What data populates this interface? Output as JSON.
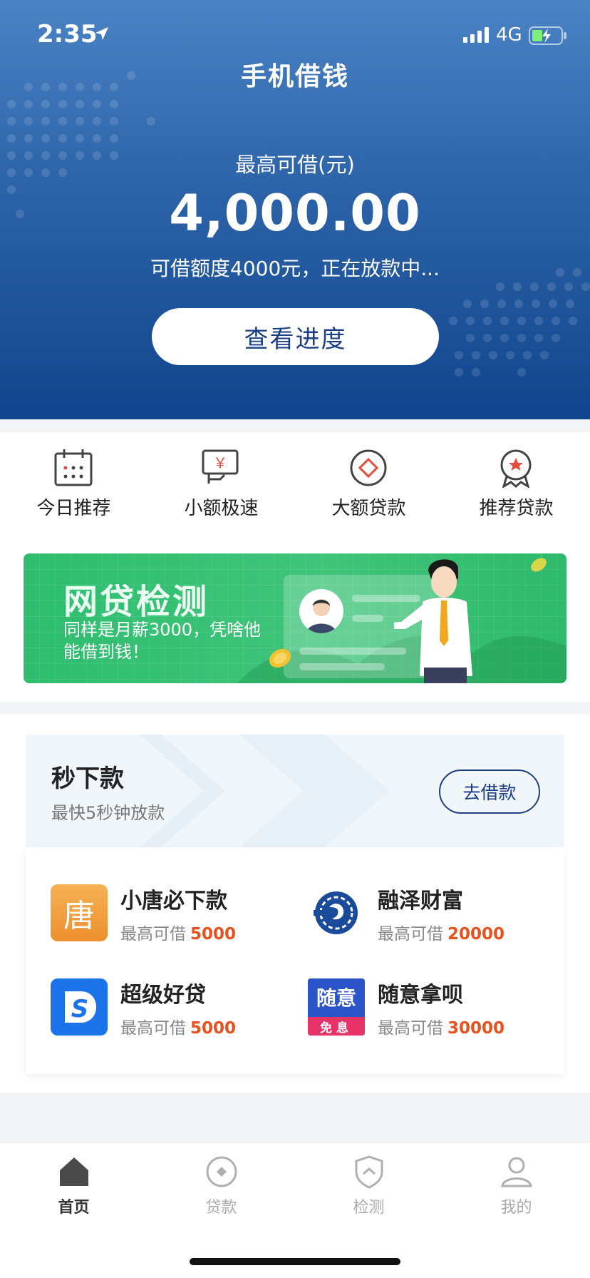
{
  "status_bar": {
    "time": "2:35",
    "network": "4G"
  },
  "header": {
    "title": "手机借钱",
    "limit_label": "最高可借(元)",
    "limit_amount": "4,000.00",
    "status_text": "可借额度4000元，正在放款中...",
    "progress_button": "查看进度"
  },
  "categories": [
    {
      "label": "今日推荐",
      "icon": "calendar-icon"
    },
    {
      "label": "小额极速",
      "icon": "money-hand-icon"
    },
    {
      "label": "大额贷款",
      "icon": "diamond-icon"
    },
    {
      "label": "推荐贷款",
      "icon": "badge-star-icon"
    }
  ],
  "banner": {
    "title": "网贷检测",
    "subtitle": "同样是月薪3000，凭啥他能借到钱！"
  },
  "loan_section": {
    "title": "秒下款",
    "subtitle": "最快5秒钟放款",
    "button": "去借款",
    "limit_prefix": "最高可借",
    "products": [
      {
        "name": "小唐必下款",
        "limit": "5000",
        "logo_text": "唐",
        "logo_color": "#f0a23f"
      },
      {
        "name": "融泽财富",
        "limit": "20000",
        "logo_color": "#1a4a9a"
      },
      {
        "name": "超级好贷",
        "limit": "5000",
        "logo_text": "S",
        "logo_color": "#1a73e8"
      },
      {
        "name": "随意拿呗",
        "limit": "30000",
        "logo_text": "随意",
        "logo_sub": "免息",
        "logo_color": "#2a54c8"
      }
    ]
  },
  "tabbar": [
    {
      "label": "首页",
      "icon": "home-icon",
      "active": true
    },
    {
      "label": "贷款",
      "icon": "loan-icon"
    },
    {
      "label": "检测",
      "icon": "shield-icon"
    },
    {
      "label": "我的",
      "icon": "user-icon"
    }
  ],
  "colors": {
    "header_top": "#4a83c4",
    "header_bottom": "#11458d",
    "accent_orange": "#e8521e",
    "navy": "#1d3f86"
  }
}
